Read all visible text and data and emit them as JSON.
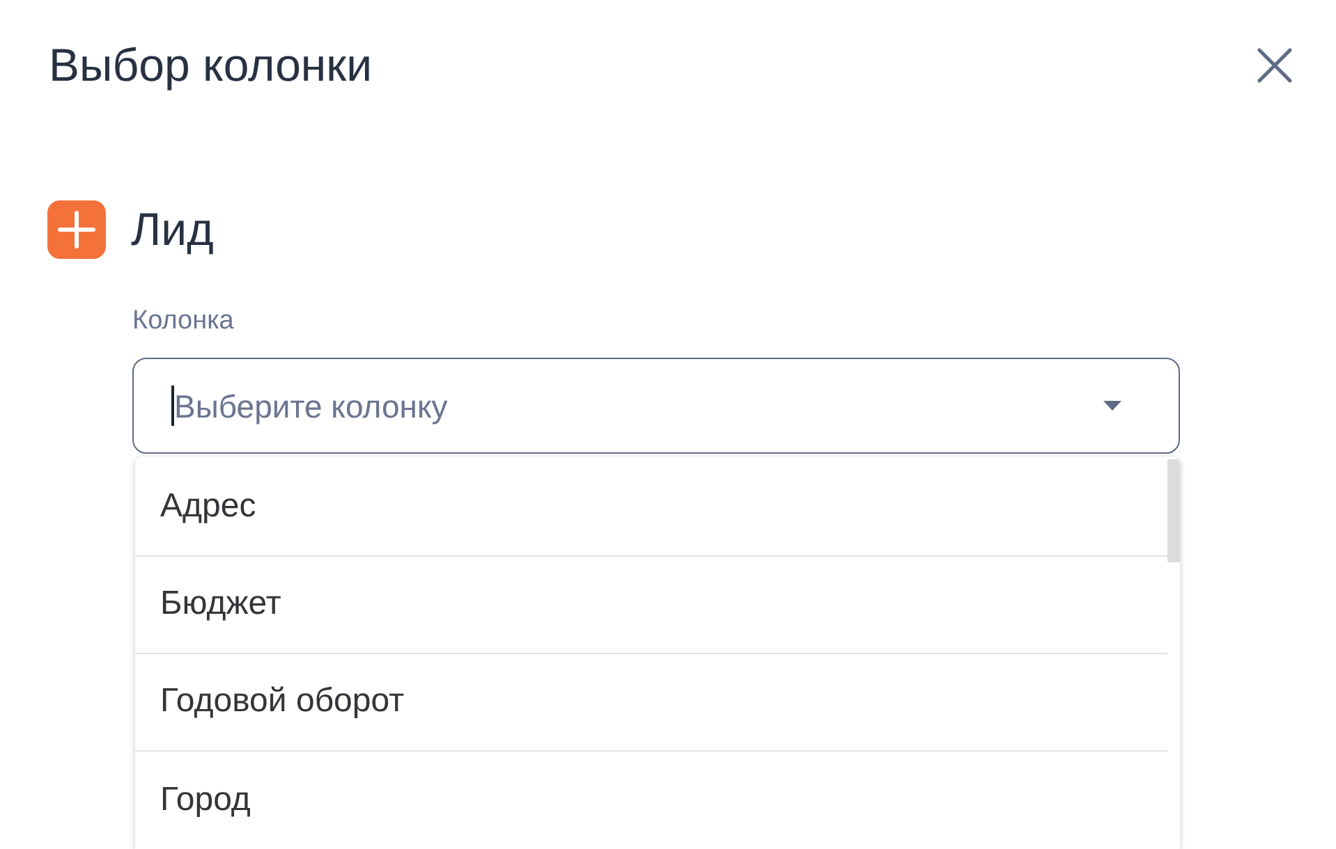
{
  "dialog": {
    "title": "Выбор колонки"
  },
  "entity": {
    "name": "Лид"
  },
  "column_field": {
    "label": "Колонка",
    "placeholder": "Выберите колонку",
    "focused": true,
    "expanded": true
  },
  "options": [
    {
      "label": "Адрес",
      "selected": false
    },
    {
      "label": "Бюджет",
      "selected": false
    },
    {
      "label": "Годовой оборот",
      "selected": false
    },
    {
      "label": "Город",
      "selected": false
    }
  ]
}
